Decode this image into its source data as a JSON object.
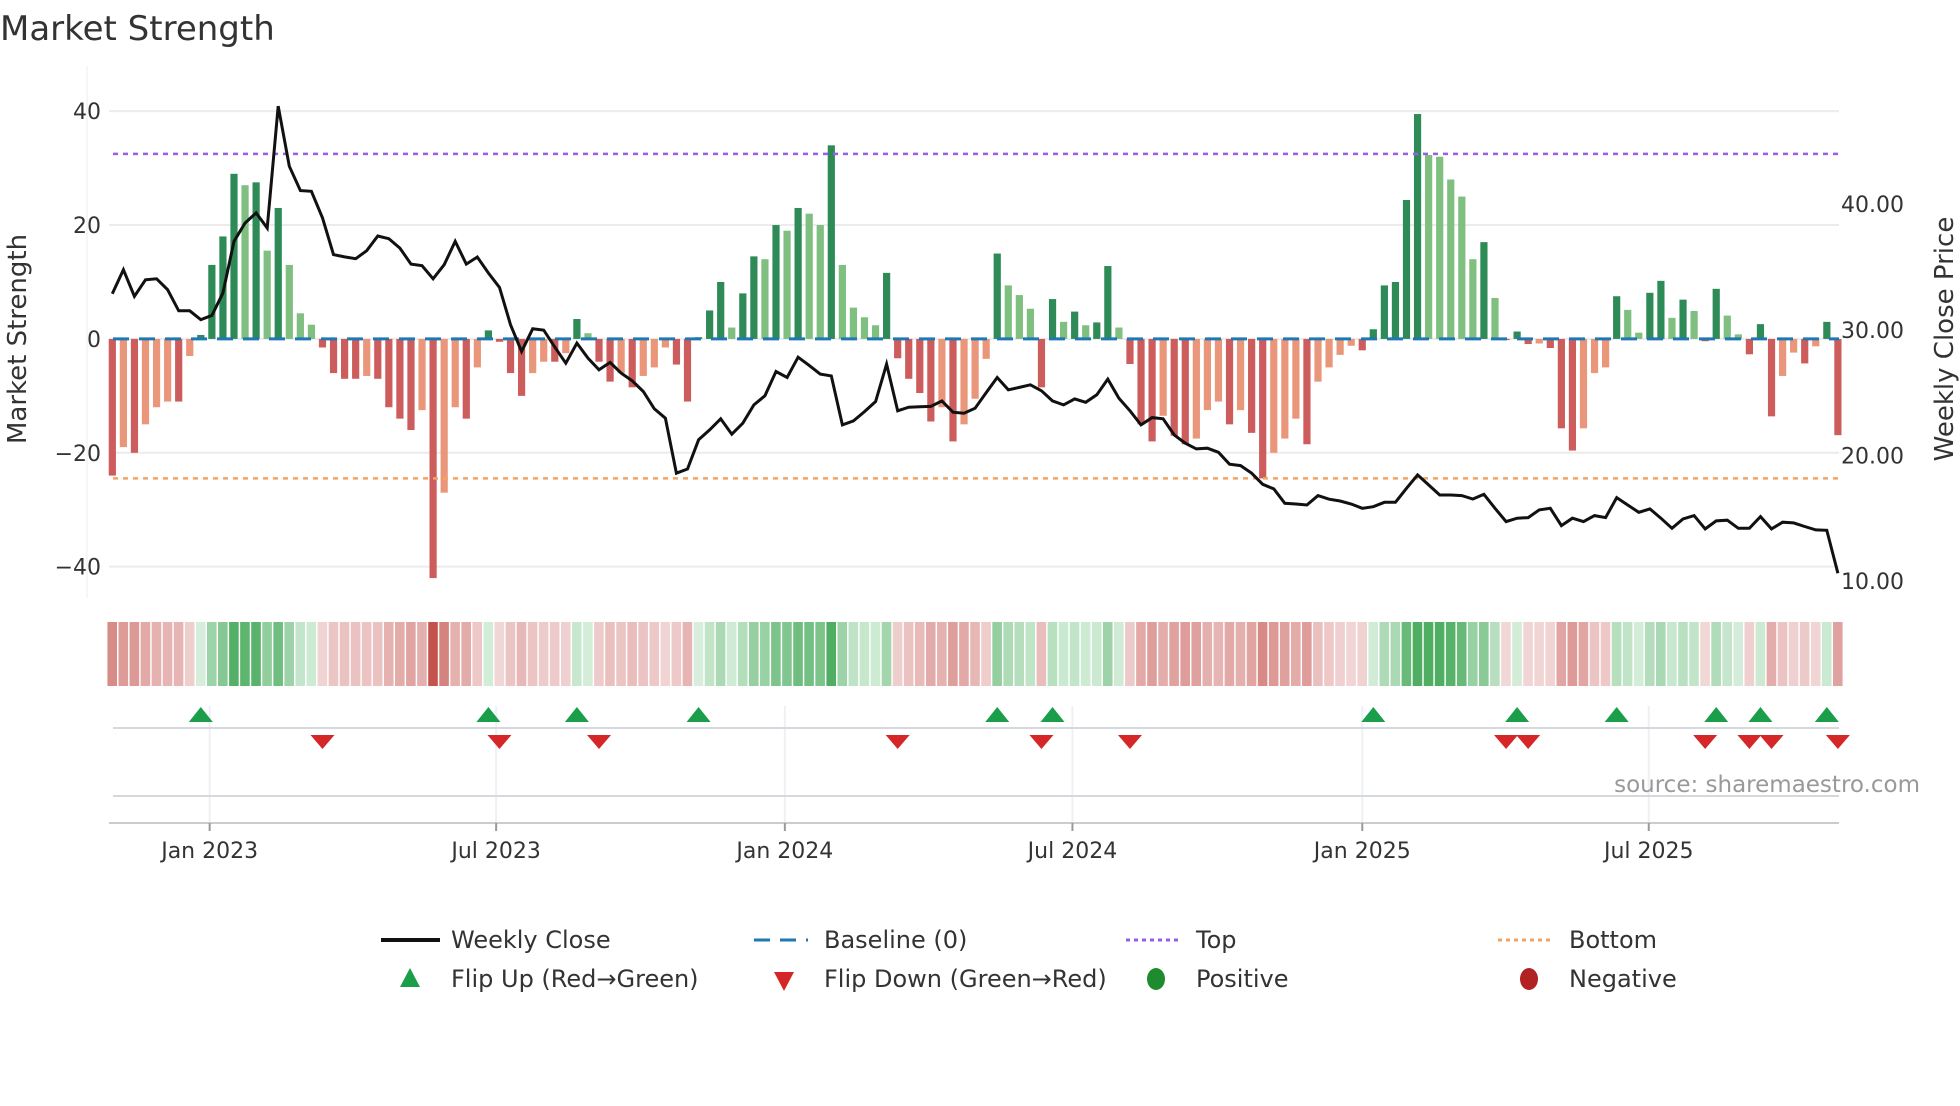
{
  "chart_data": {
    "type": "bar",
    "title": "Market Strength",
    "ylabel": "Market Strength",
    "y2label": "Weekly Close Price",
    "ylim": [
      -45.5,
      45.3
    ],
    "y2lim": [
      8.65,
      49.8
    ],
    "xlim_weeks": [
      -0.3,
      156.1
    ],
    "yticks": [
      {
        "v": 40,
        "label": "40"
      },
      {
        "v": 20,
        "label": "20"
      },
      {
        "v": 0,
        "label": "0"
      },
      {
        "v": -20,
        "label": "−20"
      },
      {
        "v": -40,
        "label": "−40"
      }
    ],
    "y2ticks": [
      {
        "v": 40,
        "label": "40.00"
      },
      {
        "v": 30,
        "label": "30.00"
      },
      {
        "v": 20,
        "label": "20.00"
      },
      {
        "v": 10,
        "label": "10.00"
      }
    ],
    "xticks": [
      {
        "week": 8.8,
        "label": "Jan 2023"
      },
      {
        "week": 34.7,
        "label": "Jul 2023"
      },
      {
        "week": 60.8,
        "label": "Jan 2024"
      },
      {
        "week": 86.8,
        "label": "Jul 2024"
      },
      {
        "week": 113.0,
        "label": "Jan 2025"
      },
      {
        "week": 138.9,
        "label": "Jul 2025"
      }
    ],
    "top": 32.5,
    "bottom": -24.5,
    "baseline": 0,
    "strength": [
      -24,
      -19,
      -20,
      -15,
      -12,
      -11,
      -11,
      -3,
      0.7,
      13,
      18,
      29,
      27,
      27.5,
      15.5,
      23,
      13,
      4.5,
      2.5,
      -1.5,
      -6,
      -7,
      -7,
      -6.5,
      -7,
      -12,
      -14,
      -16,
      -12.5,
      -42,
      -27,
      -12,
      -14,
      -5,
      1.5,
      -0.5,
      -6,
      -10,
      -6,
      -4,
      -4,
      -2.5,
      3.5,
      1,
      -4,
      -7.5,
      -6,
      -8.5,
      -6.5,
      -5,
      -1.5,
      -4.5,
      -11,
      0.3,
      5,
      10,
      2,
      8,
      14.5,
      14,
      20,
      19,
      23,
      22,
      20,
      34,
      13,
      5.5,
      3.8,
      2.4,
      11.6,
      -3.4,
      -7,
      -9.5,
      -14.5,
      -12,
      -18,
      -15,
      -10.5,
      -3.5,
      15,
      9.4,
      7.7,
      5.3,
      -8.5,
      7,
      3,
      4.8,
      2.4,
      2.9,
      12.8,
      2,
      -4.4,
      -15,
      -18,
      -13.5,
      -17,
      -18.5,
      -17.5,
      -12.5,
      -11,
      -15,
      -12.5,
      -16.5,
      -24.5,
      -20,
      -17.5,
      -14,
      -18.5,
      -7.5,
      -5,
      -2.8,
      -1.2,
      -2,
      1.7,
      9.4,
      10,
      24.4,
      39.5,
      32.3,
      32,
      28,
      25,
      14,
      17,
      7.2,
      -0.2,
      1.3,
      -0.9,
      -0.8,
      -1.6,
      -15.7,
      -19.6,
      -15.7,
      -6,
      -5,
      7.5,
      5.1,
      1.1,
      8.1,
      10.2,
      3.7,
      6.9,
      4.9,
      -0.4,
      8.8,
      4.1,
      0.8,
      -2.7,
      2.6,
      -13.6,
      -6.5,
      -2.4,
      -4.3,
      -1.3,
      3,
      -16.9
    ],
    "weekly_close": [
      32.87,
      34.78,
      32.66,
      33.98,
      34.06,
      33.19,
      31.51,
      31.51,
      30.8,
      31.14,
      32.92,
      37.04,
      38.5,
      39.3,
      38.1,
      47.8,
      43.02,
      41.08,
      41.02,
      38.9,
      35.98,
      35.8,
      35.66,
      36.29,
      37.46,
      37.25,
      36.5,
      35.23,
      35.1,
      34.06,
      35.18,
      37.04,
      35.23,
      35.79,
      34.52,
      33.37,
      30.4,
      28.27,
      30.08,
      29.97,
      28.62,
      27.34,
      28.94,
      27.74,
      26.81,
      27.4,
      26.55,
      25.94,
      25.09,
      23.71,
      22.96,
      18.58,
      18.92,
      21.24,
      22.03,
      22.91,
      21.69,
      22.56,
      24.02,
      24.74,
      26.68,
      26.2,
      27.82,
      27.16,
      26.47,
      26.33,
      22.43,
      22.75,
      23.49,
      24.29,
      27.27,
      23.55,
      23.84,
      23.87,
      23.9,
      24.34,
      23.44,
      23.36,
      23.76,
      25.0,
      26.2,
      25.22,
      25.41,
      25.62,
      25.14,
      24.34,
      24.02,
      24.5,
      24.23,
      24.82,
      26.07,
      24.55,
      23.55,
      22.43,
      23.01,
      22.91,
      21.63,
      20.97,
      20.52,
      20.57,
      20.25,
      19.3,
      19.19,
      18.58,
      17.7,
      17.33,
      16.19,
      16.13,
      16.05,
      16.8,
      16.51,
      16.37,
      16.13,
      15.79,
      15.92,
      16.27,
      16.27,
      17.38,
      18.45,
      17.65,
      16.85,
      16.85,
      16.8,
      16.53,
      16.9,
      15.79,
      14.73,
      15.0,
      15.05,
      15.66,
      15.79,
      14.41,
      15.0,
      14.73,
      15.21,
      15.05,
      16.64,
      16.05,
      15.47,
      15.74,
      15.0,
      14.2,
      14.94,
      15.21,
      14.15,
      14.79,
      14.84,
      14.2,
      14.2,
      15.13,
      14.15,
      14.68,
      14.63,
      14.34,
      14.07,
      14.04,
      10.62
    ],
    "flip_up_weeks": [
      8,
      34,
      42,
      53,
      80,
      85,
      114,
      127,
      136,
      145,
      149,
      155
    ],
    "flip_down_weeks": [
      19,
      35,
      44,
      71,
      84,
      92,
      126,
      128,
      144,
      148,
      150,
      156
    ],
    "legend": {
      "placement": "bottom",
      "items": [
        {
          "key": "weekly_close",
          "label": "Weekly Close"
        },
        {
          "key": "baseline",
          "label": "Baseline (0)"
        },
        {
          "key": "top",
          "label": "Top"
        },
        {
          "key": "bottom",
          "label": "Bottom"
        },
        {
          "key": "flip_up",
          "label": "Flip Up (Red→Green)"
        },
        {
          "key": "flip_down",
          "label": "Flip Down (Green→Red)"
        },
        {
          "key": "positive",
          "label": "Positive"
        },
        {
          "key": "negative",
          "label": "Negative"
        }
      ]
    },
    "source": "source: sharemaestro.com"
  },
  "colors": {
    "pos_dark": "#2e8b57",
    "pos_light": "#7fbf7f",
    "neg_dark": "#cd5c5c",
    "neg_light": "#e9967a",
    "top": "#9b5de5",
    "bottom": "#f4a460",
    "baseline": "#1f77b4",
    "line": "#111111",
    "flip_up": "#1a9e4a",
    "flip_down": "#d62728",
    "positive": "#1e8c2e",
    "negative": "#b22222"
  }
}
